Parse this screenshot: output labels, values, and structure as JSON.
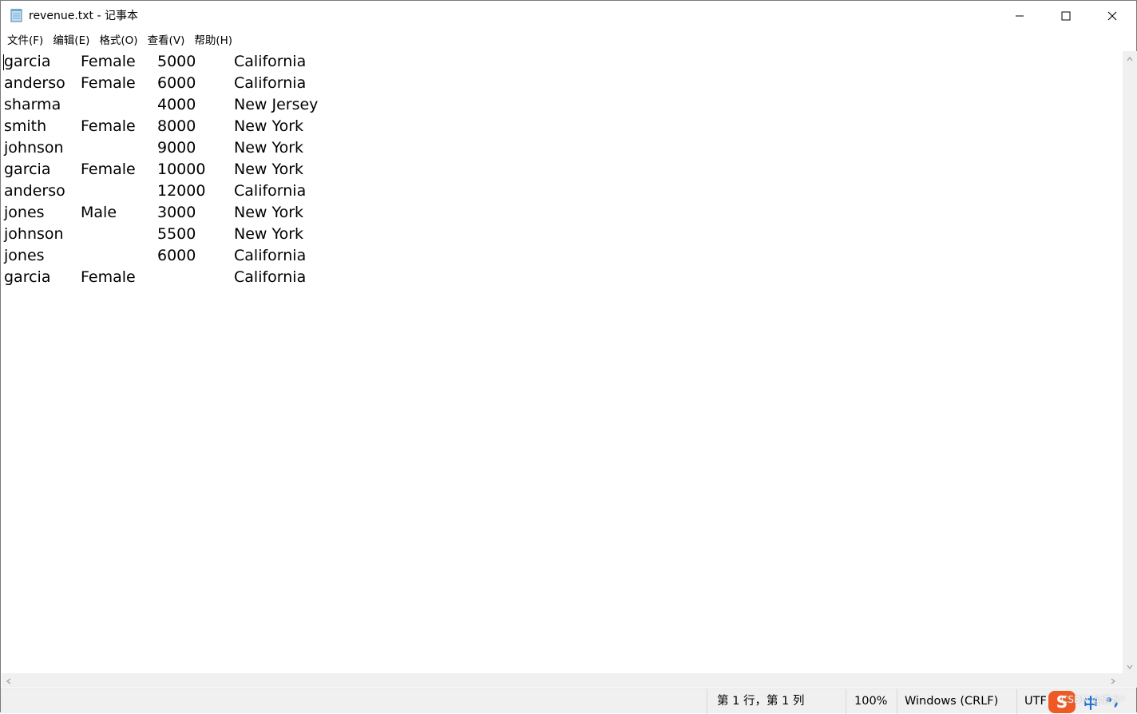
{
  "window": {
    "title": "revenue.txt - 记事本"
  },
  "icons": {
    "app": "notepad-icon",
    "minimize": "minimize-icon",
    "maximize": "maximize-icon",
    "close": "close-icon"
  },
  "menu": [
    {
      "label": "文件(F)"
    },
    {
      "label": "编辑(E)"
    },
    {
      "label": "格式(O)"
    },
    {
      "label": "查看(V)"
    },
    {
      "label": "帮助(H)"
    }
  ],
  "document": {
    "rows": [
      [
        "garcia",
        "Female",
        "5000",
        "California"
      ],
      [
        "anderso",
        "Female",
        "6000",
        "California"
      ],
      [
        "sharma",
        "",
        "4000",
        "New Jersey"
      ],
      [
        "smith",
        "Female",
        "8000",
        "New York"
      ],
      [
        "johnson",
        "",
        "9000",
        "New York"
      ],
      [
        "garcia",
        "Female",
        "10000",
        "New York"
      ],
      [
        "anderso",
        "",
        "12000",
        "California"
      ],
      [
        "jones",
        "Male",
        "3000",
        "New York"
      ],
      [
        "johnson",
        "",
        "5500",
        "New York"
      ],
      [
        "jones",
        "",
        "6000",
        "California"
      ],
      [
        "garcia",
        "Female",
        "",
        "California"
      ]
    ]
  },
  "status": {
    "position": "第 1 行，第 1 列",
    "zoom": "100%",
    "line_ending": "Windows (CRLF)",
    "encoding": "UTF"
  },
  "ime": {
    "logo": "S",
    "mode": "中",
    "punct": "•,"
  },
  "watermark": "CSDN @清水*"
}
